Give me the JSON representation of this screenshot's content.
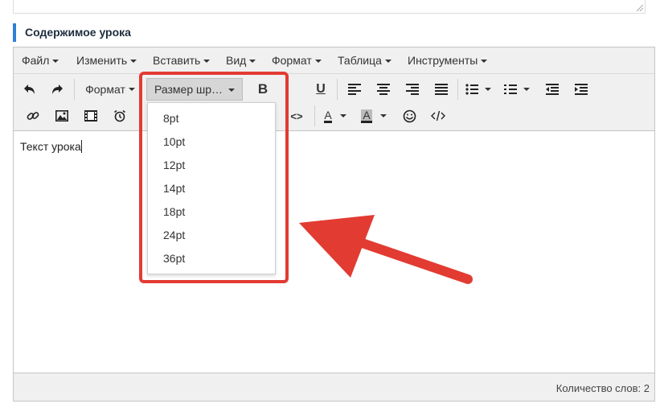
{
  "section": {
    "title": "Содержимое урока"
  },
  "menubar": {
    "items": [
      {
        "label": "Файл",
        "name": "menu-file"
      },
      {
        "label": "Изменить",
        "name": "menu-edit"
      },
      {
        "label": "Вставить",
        "name": "menu-insert"
      },
      {
        "label": "Вид",
        "name": "menu-view"
      },
      {
        "label": "Формат",
        "name": "menu-format"
      },
      {
        "label": "Таблица",
        "name": "menu-table"
      },
      {
        "label": "Инструменты",
        "name": "menu-tools"
      }
    ]
  },
  "toolbar": {
    "format_label": "Формат",
    "font_size_label": "Размер шр…",
    "bold_label": "B",
    "underline_label": "U",
    "icons_row1": [
      "undo-icon",
      "redo-icon",
      "bold-icon",
      "italic-icon",
      "underline-icon",
      "align-left-icon",
      "align-center-icon",
      "align-right-icon",
      "align-justify-icon",
      "bullet-list-icon",
      "numbered-list-icon",
      "outdent-icon",
      "indent-icon"
    ],
    "icons_row2": [
      "link-icon",
      "image-icon",
      "media-icon",
      "alarm-icon",
      "code-sample-icon",
      "text-color-icon",
      "background-color-icon",
      "emoticons-icon",
      "source-code-icon"
    ]
  },
  "font_size_dropdown": {
    "options": [
      "8pt",
      "10pt",
      "12pt",
      "14pt",
      "18pt",
      "24pt",
      "36pt"
    ]
  },
  "content": {
    "text": "Текст урока"
  },
  "status": {
    "word_count": "Количество слов: 2"
  },
  "colors": {
    "accent": "#2f7fd8",
    "annotation": "#e23b32"
  }
}
